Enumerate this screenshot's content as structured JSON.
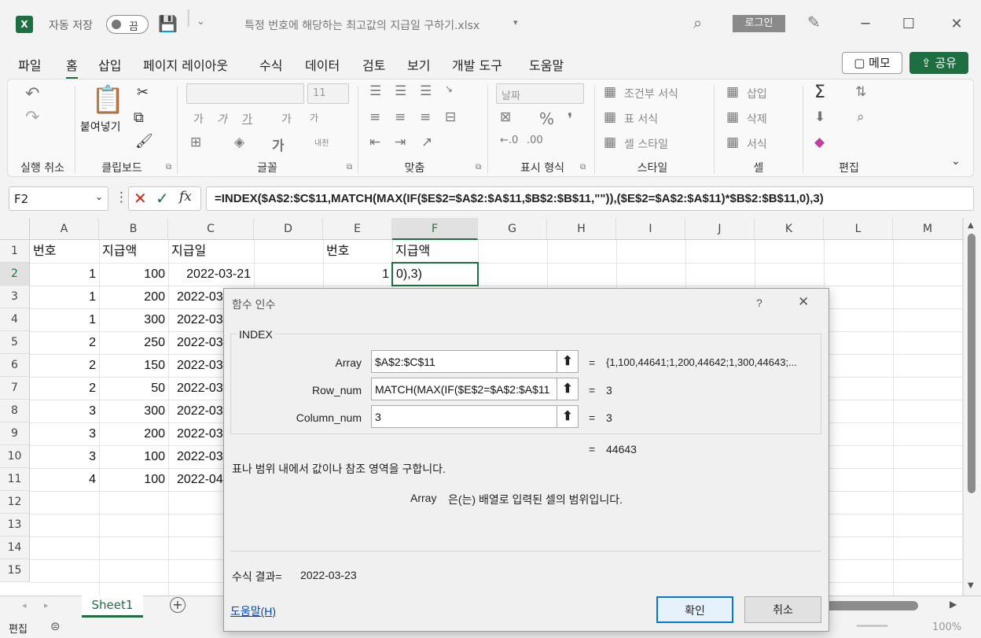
{
  "titlebar": {
    "app_icon": "X",
    "autosave_label": "자동 저장",
    "autosave_state": "끔",
    "filename": "특정 번호에 해당하는 최고값의 지급일 구하기.xlsx",
    "login": "로그인"
  },
  "menu": [
    "파일",
    "홈",
    "삽입",
    "페이지 레이아웃",
    "수식",
    "데이터",
    "검토",
    "보기",
    "개발 도구",
    "도움말"
  ],
  "menu_active": "홈",
  "buttons": {
    "memo": "메모",
    "share": "공유"
  },
  "ribbon": {
    "groups": [
      "실행 취소",
      "클립보드",
      "글꼴",
      "맞춤",
      "표시 형식",
      "스타일",
      "셀",
      "편집"
    ],
    "paste": "붙여넣기",
    "font_size": "11",
    "number_format": "날짜",
    "font_buttons": [
      "가",
      "가",
      "가",
      "가^",
      "가ˇ"
    ],
    "styles": [
      "조건부 서식",
      "표 서식",
      "셀 스타일"
    ],
    "cells": [
      "삽입",
      "삭제",
      "서식"
    ],
    "wrap_label": "내천",
    "font_size_glyphs": [
      "가",
      "가"
    ]
  },
  "formula_bar": {
    "name_box": "F2",
    "fx": "fx",
    "formula": "=INDEX($A$2:$C$11,MATCH(MAX(IF($E$2=$A$2:$A$11,$B$2:$B$11,\"\")),($E$2=$A$2:$A$11)*$B$2:$B$11,0),3)"
  },
  "sheet": {
    "columns": [
      "A",
      "B",
      "C",
      "D",
      "E",
      "F",
      "G",
      "H",
      "I",
      "J",
      "K",
      "L",
      "M"
    ],
    "rows": [
      "1",
      "2",
      "3",
      "4",
      "5",
      "6",
      "7",
      "8",
      "9",
      "10",
      "11",
      "12",
      "13",
      "14",
      "15"
    ],
    "headers": {
      "A1": "번호",
      "B1": "지급액",
      "C1": "지급일",
      "E1": "번호",
      "F1": "지급액"
    },
    "data": [
      {
        "a": "1",
        "b": "100",
        "c": "2022-03-21"
      },
      {
        "a": "1",
        "b": "200",
        "c": "2022-03"
      },
      {
        "a": "1",
        "b": "300",
        "c": "2022-03"
      },
      {
        "a": "2",
        "b": "250",
        "c": "2022-03"
      },
      {
        "a": "2",
        "b": "150",
        "c": "2022-03"
      },
      {
        "a": "2",
        "b": "50",
        "c": "2022-03"
      },
      {
        "a": "3",
        "b": "300",
        "c": "2022-03"
      },
      {
        "a": "3",
        "b": "200",
        "c": "2022-03"
      },
      {
        "a": "3",
        "b": "100",
        "c": "2022-03"
      },
      {
        "a": "4",
        "b": "100",
        "c": "2022-04"
      }
    ],
    "E2": "1",
    "F2": "0),3)",
    "sheet_tab": "Sheet1"
  },
  "statusbar": {
    "mode": "편집",
    "zoom": "100%"
  },
  "dialog": {
    "title": "함수 인수",
    "help_q": "?",
    "function_name": "INDEX",
    "args": [
      {
        "label": "Array",
        "value": "$A$2:$C$11",
        "eq": "=",
        "result": "{1,100,44641;1,200,44642;1,300,44643;..."
      },
      {
        "label": "Row_num",
        "value": "MATCH(MAX(IF($E$2=$A$2:$A$11",
        "eq": "=",
        "result": "3"
      },
      {
        "label": "Column_num",
        "value": "3",
        "eq": "=",
        "result": "3"
      }
    ],
    "total_eq": "=",
    "total_result": "44643",
    "description": "표나 범위 내에서 값이나 참조 영역을 구합니다.",
    "arg_help_name": "Array",
    "arg_help": "은(는) 배열로 입력된 셀의 범위입니다.",
    "formula_result_label": "수식 결과=",
    "formula_result": "2022-03-23",
    "help_link": "도움말(H)",
    "ok": "확인",
    "cancel": "취소"
  }
}
